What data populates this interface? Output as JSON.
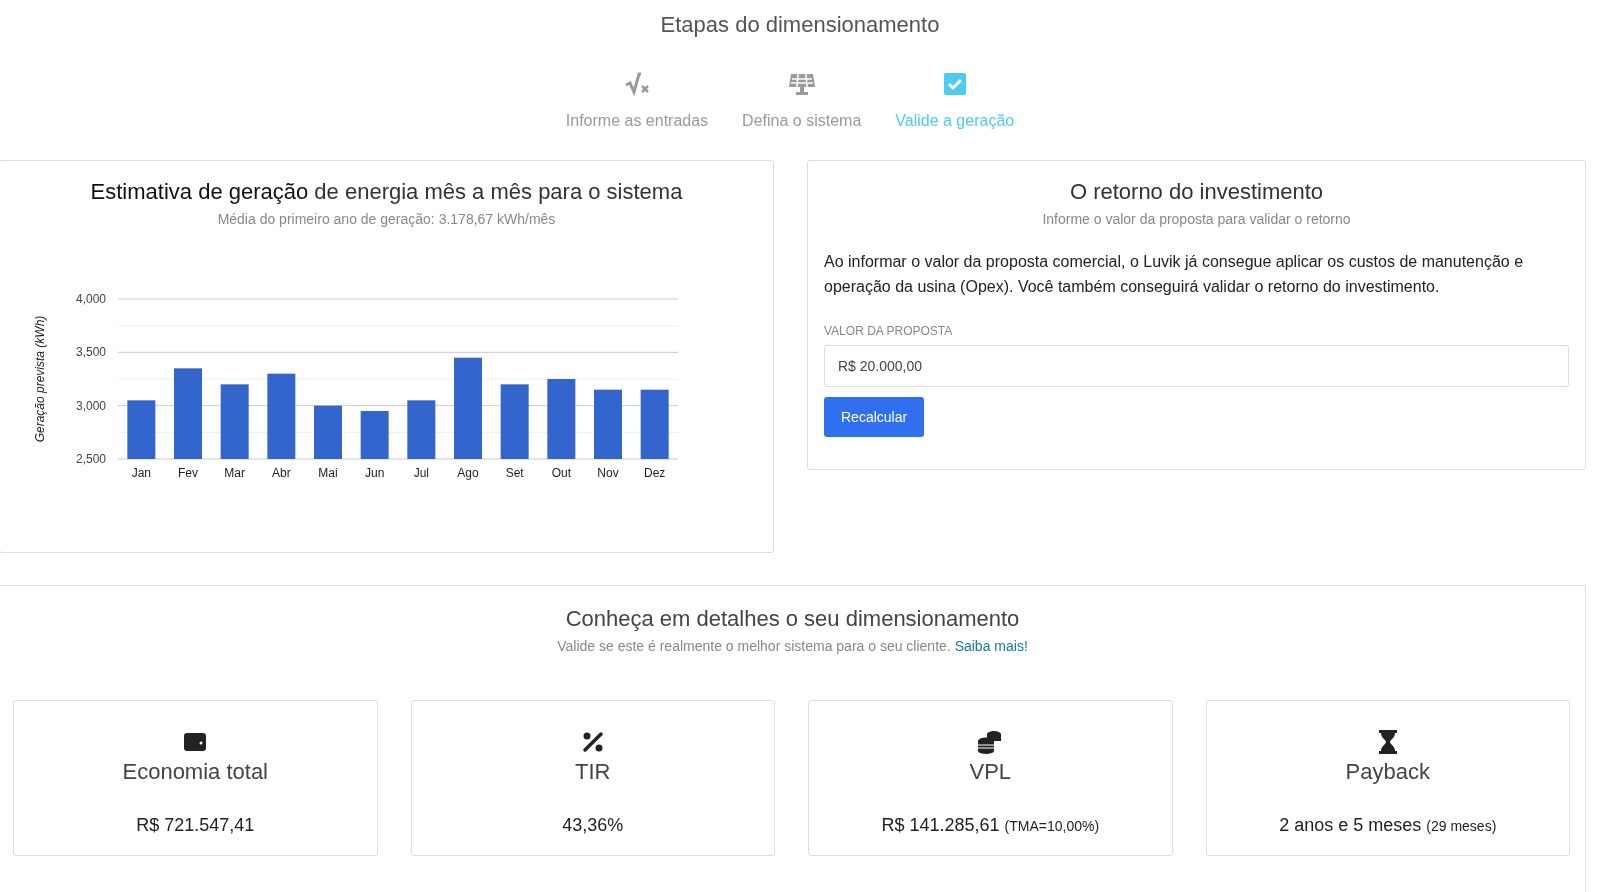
{
  "header": {
    "title": "Etapas do dimensionamento"
  },
  "steps": [
    {
      "kind": "formula",
      "label": "Informe as entradas",
      "selected": false
    },
    {
      "kind": "panel",
      "label": "Defina o sistema",
      "selected": false
    },
    {
      "kind": "check",
      "label": "Valide a geração",
      "selected": true
    }
  ],
  "generation": {
    "title": "**Estimativa de geração** de energia mês a mês para o sistema",
    "subtitle": "Média do primeiro ano de geração: 3.178,67 kWh/mês",
    "chart_data": {
      "type": "bar",
      "ylabel": "Geração prevista (kWh)",
      "categories": [
        "Jan",
        "Fev",
        "Mar",
        "Abr",
        "Mai",
        "Jun",
        "Jul",
        "Ago",
        "Set",
        "Out",
        "Nov",
        "Dez"
      ],
      "series": [
        {
          "color": "#3366cc",
          "values": [
            3050,
            3350,
            3200,
            3300,
            3000,
            2950,
            3050,
            3450,
            3200,
            3250,
            3150,
            3150
          ]
        }
      ],
      "ylim": [
        2500,
        4000
      ],
      "yticks": [
        {
          "value": 2500,
          "label": "2,500"
        },
        {
          "value": 3000,
          "label": "3,000"
        },
        {
          "value": 3500,
          "label": "3,500"
        },
        {
          "value": 4000,
          "label": "4,000"
        }
      ]
    }
  },
  "investment": {
    "title": "O retorno do investimento",
    "subtitle": "Informe o valor da proposta para validar o retorno",
    "description": "Ao informar o valor da proposta comercial, o Luvik já consegue aplicar os custos de manutenção e operação da usina (Opex). Você também conseguirá validar o retorno do investimento.",
    "field_label": "VALOR DA PROPOSTA",
    "field_value": "R$ 20.000,00",
    "button": "Recalcular"
  },
  "details": {
    "title": "Conheça em detalhes o seu dimensionamento",
    "subtitle": "Valide se este é realmente o melhor sistema para o seu cliente.",
    "link": "Saiba mais!",
    "cards": [
      {
        "kind": "wallet",
        "title": "Economia total",
        "value": "R$ 721.547,41"
      },
      {
        "kind": "percent",
        "title": "TIR",
        "value": "43,36%"
      },
      {
        "kind": "coins",
        "title": "VPL",
        "value": "R$ 141.285,61",
        "note": "(TMA=10,00%)"
      },
      {
        "kind": "hourglass",
        "title": "Payback",
        "value": "2 anos e 5 meses",
        "note": "(29 meses)"
      }
    ]
  }
}
